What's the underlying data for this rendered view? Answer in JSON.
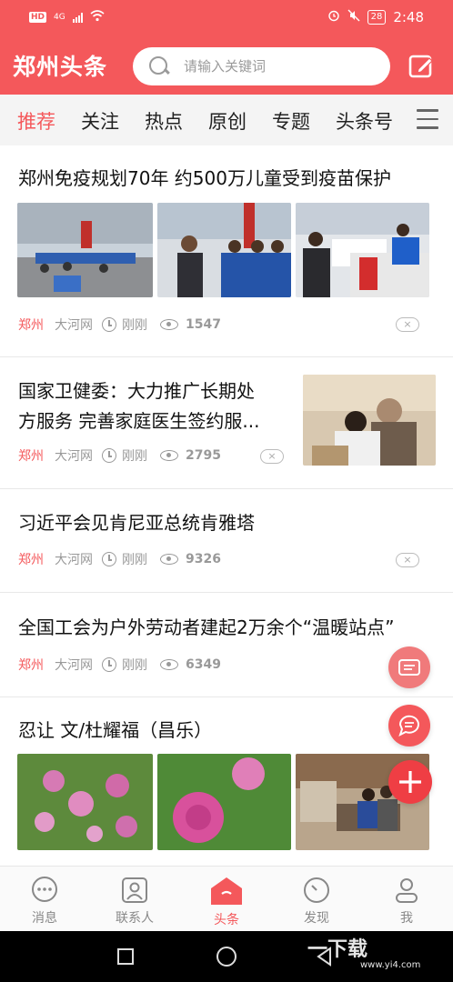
{
  "status_bar": {
    "left_badge": "HD",
    "network": "4G",
    "battery": "28",
    "time": "2:48"
  },
  "header": {
    "app_title": "郑州头条",
    "search_placeholder": "请输入关键词",
    "accent_color": "#f4585b"
  },
  "tabs": [
    {
      "label": "推荐",
      "active": true
    },
    {
      "label": "关注"
    },
    {
      "label": "热点"
    },
    {
      "label": "原创"
    },
    {
      "label": "专题"
    },
    {
      "label": "头条号"
    }
  ],
  "articles": [
    {
      "title": "郑州免疫规划70年 约500万儿童受到疫苗保护",
      "source": "郑州",
      "publisher": "大河网",
      "time": "刚刚",
      "views": "1547"
    },
    {
      "title_line1": "国家卫健委：大力推广长期处",
      "title_line2": "方服务 完善家庭医生签约服...",
      "source": "郑州",
      "publisher": "大河网",
      "time": "刚刚",
      "views": "2795"
    },
    {
      "title": "习近平会见肯尼亚总统肯雅塔",
      "source": "郑州",
      "publisher": "大河网",
      "time": "刚刚",
      "views": "9326"
    },
    {
      "title": "全国工会为户外劳动者建起2万余个“温暖站点”",
      "source": "郑州",
      "publisher": "大河网",
      "time": "刚刚",
      "views": "6349"
    },
    {
      "title": "忍让 文/杜耀福（昌乐）"
    }
  ],
  "bottom_nav": [
    {
      "label": "消息",
      "icon": "chat-bubble-icon"
    },
    {
      "label": "联系人",
      "icon": "contacts-icon"
    },
    {
      "label": "头条",
      "icon": "home-icon",
      "active": true
    },
    {
      "label": "发现",
      "icon": "compass-icon"
    },
    {
      "label": "我",
      "icon": "user-icon"
    }
  ],
  "watermark": {
    "text": "一下载",
    "url": "www.yi4.com"
  }
}
